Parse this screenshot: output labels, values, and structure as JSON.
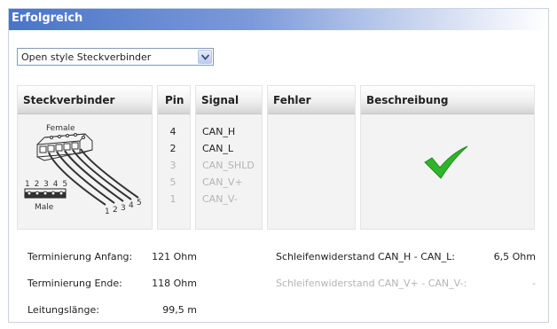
{
  "header": {
    "title": "Erfolgreich"
  },
  "select": {
    "value": "Open style Steckverbinder"
  },
  "columns": {
    "connector": "Steckverbinder",
    "pin": "Pin",
    "signal": "Signal",
    "error": "Fehler",
    "description": "Beschreibung"
  },
  "connector_image": {
    "female_label": "Female",
    "male_label": "Male",
    "male_pins": "1 2 3 4 5",
    "wire_pins": [
      "1",
      "2",
      "3",
      "4",
      "5"
    ]
  },
  "pins": [
    {
      "pin": "4",
      "signal": "CAN_H",
      "active": true
    },
    {
      "pin": "2",
      "signal": "CAN_L",
      "active": true
    },
    {
      "pin": "3",
      "signal": "CAN_SHLD",
      "active": false
    },
    {
      "pin": "5",
      "signal": "CAN_V+",
      "active": false
    },
    {
      "pin": "1",
      "signal": "CAN_V-",
      "active": false
    }
  ],
  "result_icon": "checkmark-icon",
  "colors": {
    "accent": "#4a74c9",
    "success": "#2fb52a",
    "inactive_text": "#b4b4b4"
  },
  "measurements": {
    "termination_start": {
      "label": "Terminierung Anfang:",
      "value": "121 Ohm"
    },
    "termination_end": {
      "label": "Terminierung Ende:",
      "value": "118 Ohm"
    },
    "cable_length": {
      "label": "Leitungslänge:",
      "value": "99,5 m"
    },
    "loop_resistance_can": {
      "label": "Schleifenwiderstand CAN_H - CAN_L:",
      "value": "6,5 Ohm"
    },
    "loop_resistance_v": {
      "label": "Schleifenwiderstand CAN_V+ - CAN_V-:",
      "value": "-"
    }
  }
}
